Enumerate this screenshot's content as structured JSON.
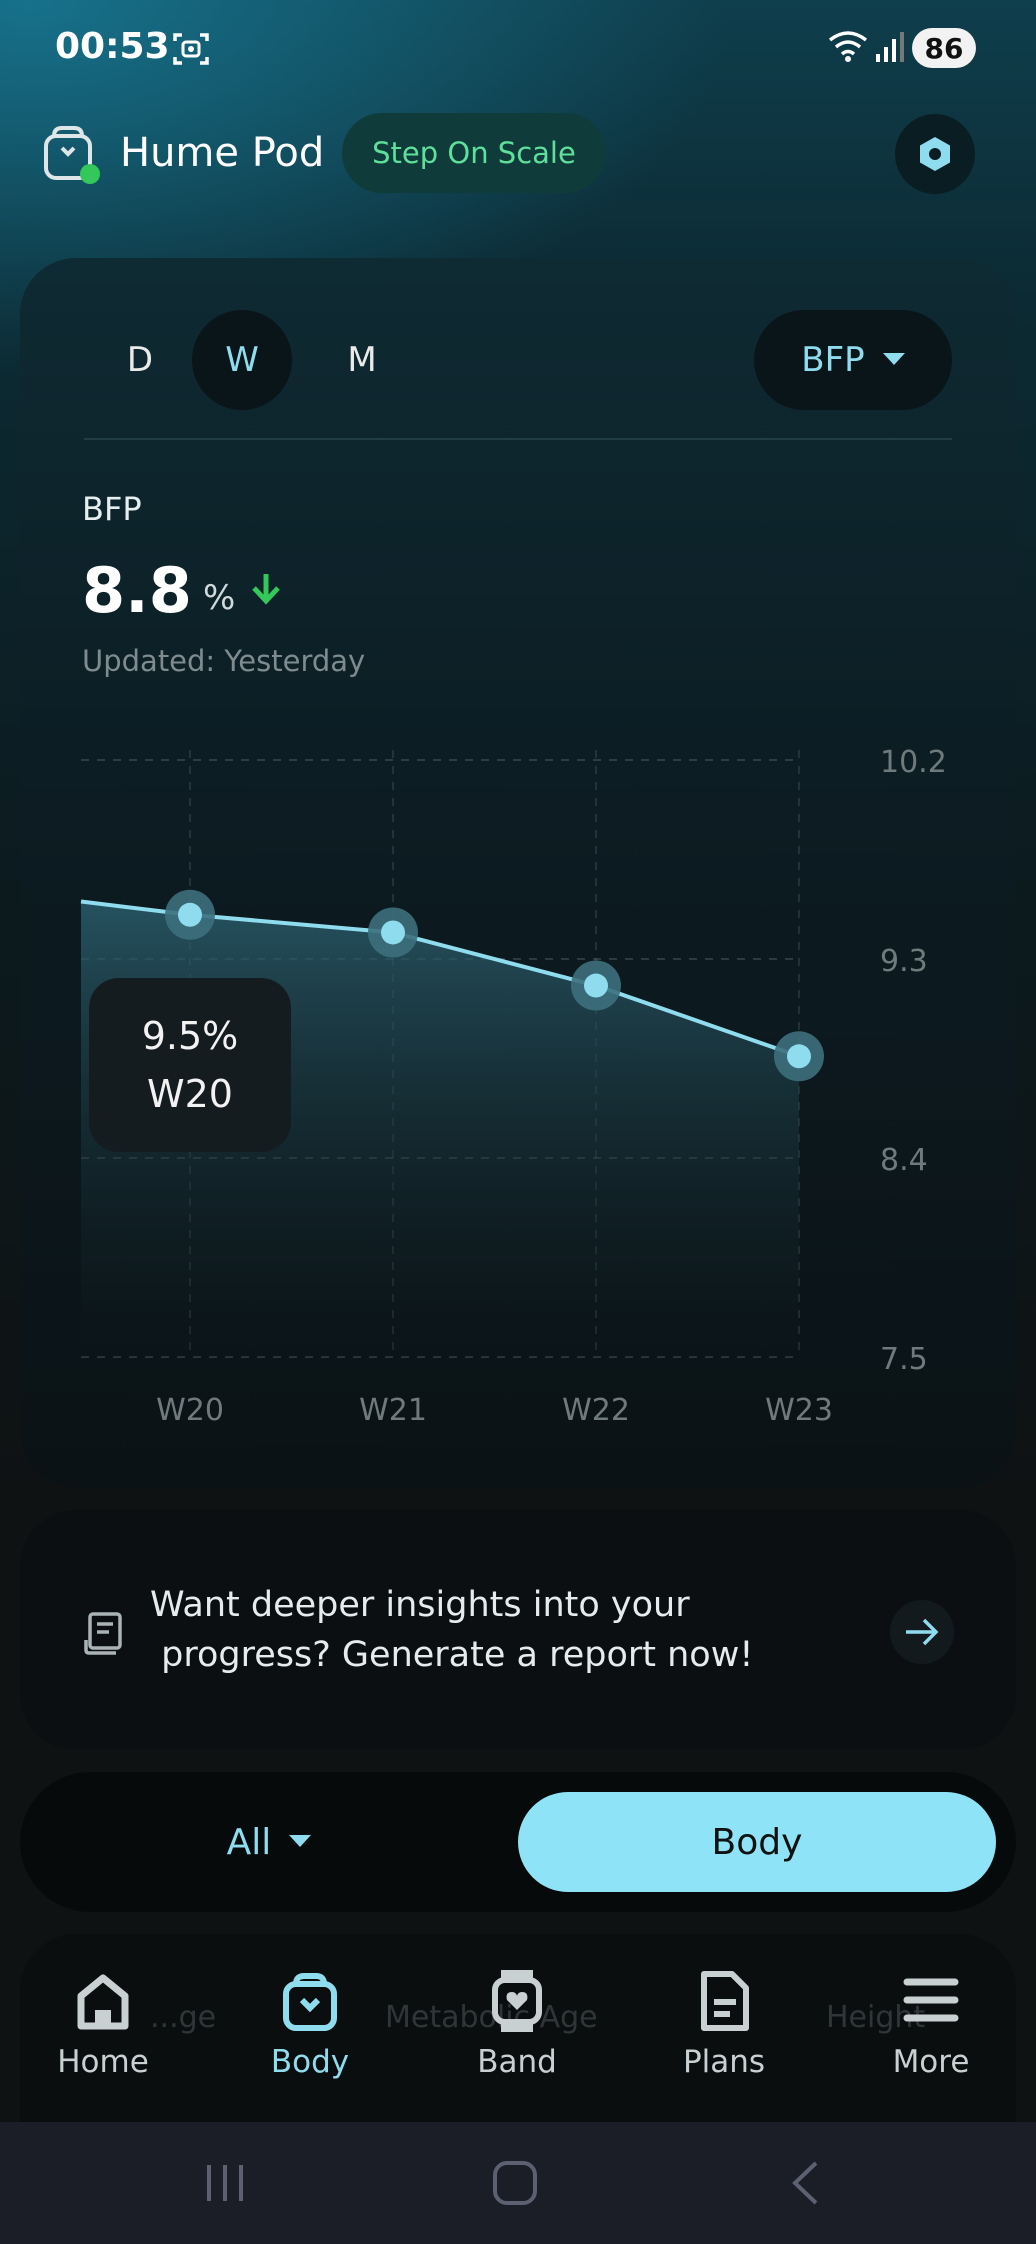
{
  "status_bar": {
    "time": "00:53",
    "battery": "86"
  },
  "header": {
    "device_name": "Hume Pod",
    "step_button": "Step On Scale"
  },
  "chart_card": {
    "periods": [
      "D",
      "W",
      "M"
    ],
    "active_period": "W",
    "metric_select": "BFP",
    "metric_label": "BFP",
    "metric_value": "8.8",
    "metric_unit": "%",
    "updated": "Updated: Yesterday",
    "tooltip": {
      "value": "9.5%",
      "label": "W20"
    }
  },
  "chart_data": {
    "type": "area",
    "categories": [
      "W20",
      "W21",
      "W22",
      "W23"
    ],
    "series": [
      {
        "values": [
          9.5,
          9.42,
          9.18,
          8.86
        ]
      }
    ],
    "leading_value": 9.56,
    "y_ticks": [
      "10.2",
      "9.3",
      "8.4",
      "7.5"
    ],
    "ylim": [
      7.5,
      10.2
    ],
    "grid": true,
    "selected": "W20",
    "colors": {
      "line": "#8fdcef",
      "point": "#8fdcef"
    }
  },
  "report_card": {
    "line1": "Want deeper insights into your",
    "line2": " progress? Generate a report now!"
  },
  "segment": {
    "all_label": "All",
    "body_label": "Body"
  },
  "ghost_labels": [
    "...ge",
    "Metabolic Age",
    "Height"
  ],
  "tabs": [
    {
      "label": "Home",
      "icon": "home-icon"
    },
    {
      "label": "Body",
      "icon": "body-icon",
      "active": true
    },
    {
      "label": "Band",
      "icon": "band-icon"
    },
    {
      "label": "Plans",
      "icon": "plans-icon"
    },
    {
      "label": "More",
      "icon": "menu-icon"
    }
  ]
}
